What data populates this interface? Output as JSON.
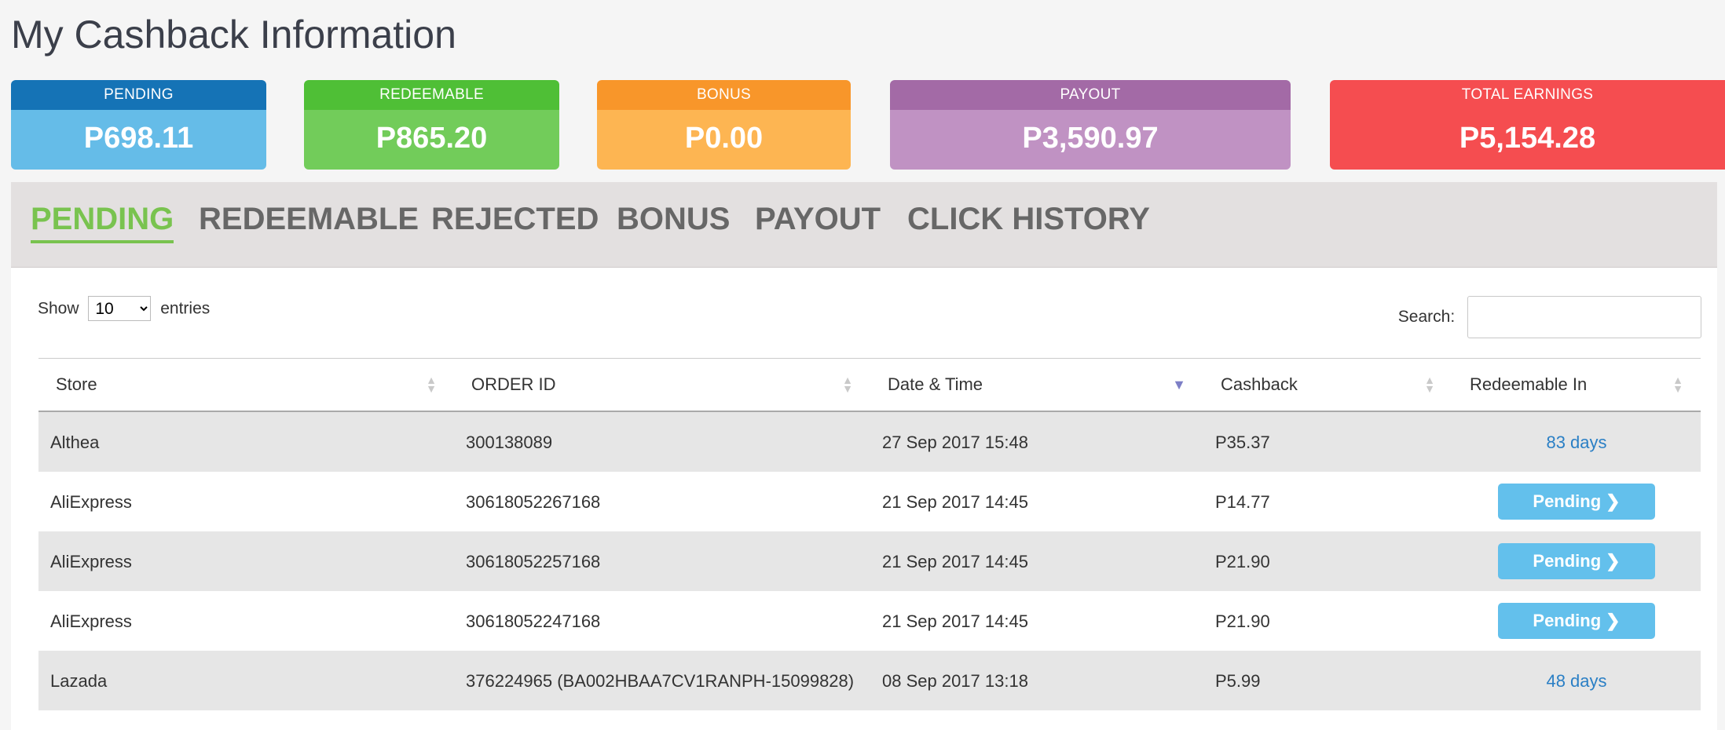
{
  "page": {
    "title": "My Cashback Information"
  },
  "cards": [
    {
      "key": "pending",
      "label": "PENDING",
      "value": "P698.11",
      "head_color": "#1573b6",
      "body_color": "#65bce8"
    },
    {
      "key": "redeemable",
      "label": "REDEEMABLE",
      "value": "P865.20",
      "head_color": "#4fbf36",
      "body_color": "#72cc5a"
    },
    {
      "key": "bonus",
      "label": "BONUS",
      "value": "P0.00",
      "head_color": "#f8962a",
      "body_color": "#fdb552"
    },
    {
      "key": "payout",
      "label": "PAYOUT",
      "value": "P3,590.97",
      "head_color": "#a36aa6",
      "body_color": "#c092c3"
    },
    {
      "key": "total",
      "label": "TOTAL EARNINGS",
      "value": "P5,154.28",
      "head_color": "#f54d50",
      "body_color": "#f54d50"
    }
  ],
  "tabs": [
    "PENDING",
    "REDEEMABLE",
    "REJECTED",
    "BONUS",
    "PAYOUT",
    "CLICK HISTORY"
  ],
  "active_tab": "PENDING",
  "accent_color": "#79c34f",
  "length": {
    "show_label": "Show",
    "selected": "10",
    "entries_label": "entries"
  },
  "search": {
    "label": "Search:",
    "value": ""
  },
  "table": {
    "columns": [
      "Store",
      "ORDER ID",
      "Date & Time",
      "Cashback",
      "Redeemable In"
    ],
    "sorted_column": "Date & Time",
    "rows": [
      {
        "store": "Althea",
        "order_id": "300138089",
        "date": "27 Sep 2017 15:48",
        "cashback": "P35.37",
        "redeemable": "83 days",
        "redeemable_type": "days"
      },
      {
        "store": "AliExpress",
        "order_id": "30618052267168",
        "date": "21 Sep 2017 14:45",
        "cashback": "P14.77",
        "redeemable": "Pending",
        "redeemable_type": "button"
      },
      {
        "store": "AliExpress",
        "order_id": "30618052257168",
        "date": "21 Sep 2017 14:45",
        "cashback": "P21.90",
        "redeemable": "Pending",
        "redeemable_type": "button"
      },
      {
        "store": "AliExpress",
        "order_id": "30618052247168",
        "date": "21 Sep 2017 14:45",
        "cashback": "P21.90",
        "redeemable": "Pending",
        "redeemable_type": "button"
      },
      {
        "store": "Lazada",
        "order_id": "376224965 (BA002HBAA7CV1RANPH-15099828)",
        "date": "08 Sep 2017 13:18",
        "cashback": "P5.99",
        "redeemable": "48 days",
        "redeemable_type": "days"
      }
    ]
  }
}
